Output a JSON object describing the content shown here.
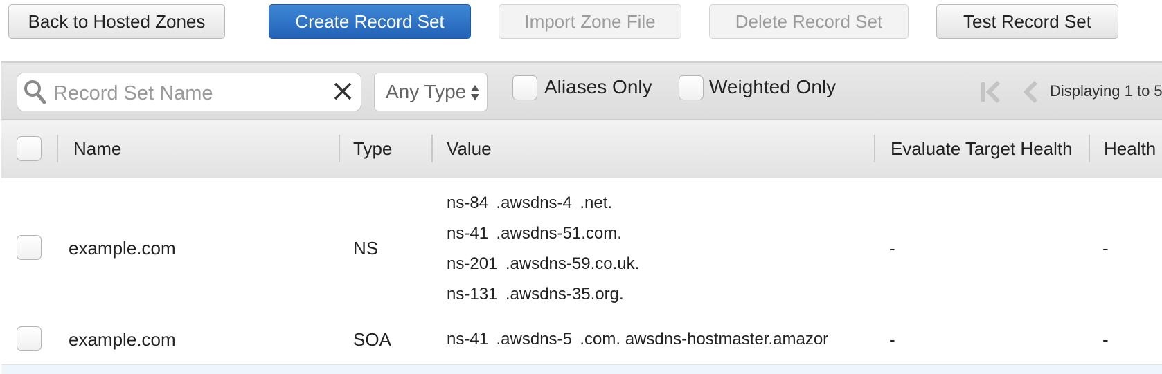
{
  "toolbar": {
    "back_label": "Back to Hosted Zones",
    "create_label": "Create Record Set",
    "import_label": "Import Zone File",
    "delete_label": "Delete Record Set",
    "test_label": "Test Record Set"
  },
  "filters": {
    "search_placeholder": "Record Set Name",
    "search_value": "",
    "type_selected": "Any Type",
    "aliases_only_label": "Aliases Only",
    "weighted_only_label": "Weighted Only",
    "pagination_text": "Displaying 1 to 5"
  },
  "table": {
    "columns": [
      "Name",
      "Type",
      "Value",
      "Evaluate Target Health",
      "Health"
    ],
    "rows": [
      {
        "name": "example.com",
        "type": "NS",
        "values": [
          "ns-84  .awsdns-4  .net.",
          "ns-41  .awsdns-51.com.",
          "ns-201  .awsdns-59.co.uk.",
          "ns-131  .awsdns-35.org."
        ],
        "evaluate_target_health": "-",
        "health": "-"
      },
      {
        "name": "example.com",
        "type": "SOA",
        "values": [
          "ns-41  .awsdns-5  .com. awsdns-hostmaster.amazor"
        ],
        "evaluate_target_health": "-",
        "health": "-"
      }
    ]
  },
  "colors": {
    "primary_button": "#2a6fc6",
    "header_gradient_top": "#f3f3f3",
    "header_gradient_bottom": "#e2e2e2"
  }
}
